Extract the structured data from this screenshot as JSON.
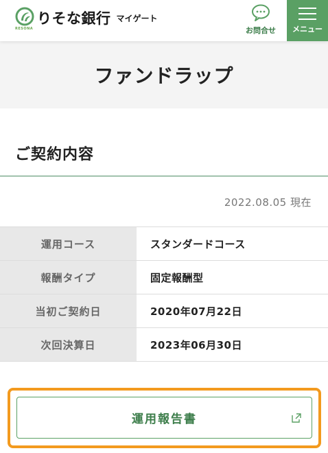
{
  "header": {
    "bank_name": "りそな銀行",
    "bank_subname": "RESONA",
    "service_name": "マイゲート",
    "contact_label": "お問合せ",
    "menu_label": "メニュー"
  },
  "page": {
    "title": "ファンドラップ"
  },
  "contract": {
    "heading": "ご契約内容",
    "as_of": "2022.08.05 現在",
    "rows": [
      {
        "label": "運用コース",
        "value": "スタンダードコース"
      },
      {
        "label": "報酬タイプ",
        "value": "固定報酬型"
      },
      {
        "label": "当初ご契約日",
        "value": "2020年07月22日"
      },
      {
        "label": "次回決算日",
        "value": "2023年06月30日"
      }
    ]
  },
  "actions": {
    "report_label": "運用報告書"
  },
  "colors": {
    "brand_green": "#5aa064",
    "text_green": "#3c7d4a",
    "highlight_orange": "#f39a1e"
  },
  "icons": {
    "logo": "resona-logo-icon",
    "contact": "chat-bubble-icon",
    "menu": "hamburger-icon",
    "external": "external-link-icon"
  }
}
